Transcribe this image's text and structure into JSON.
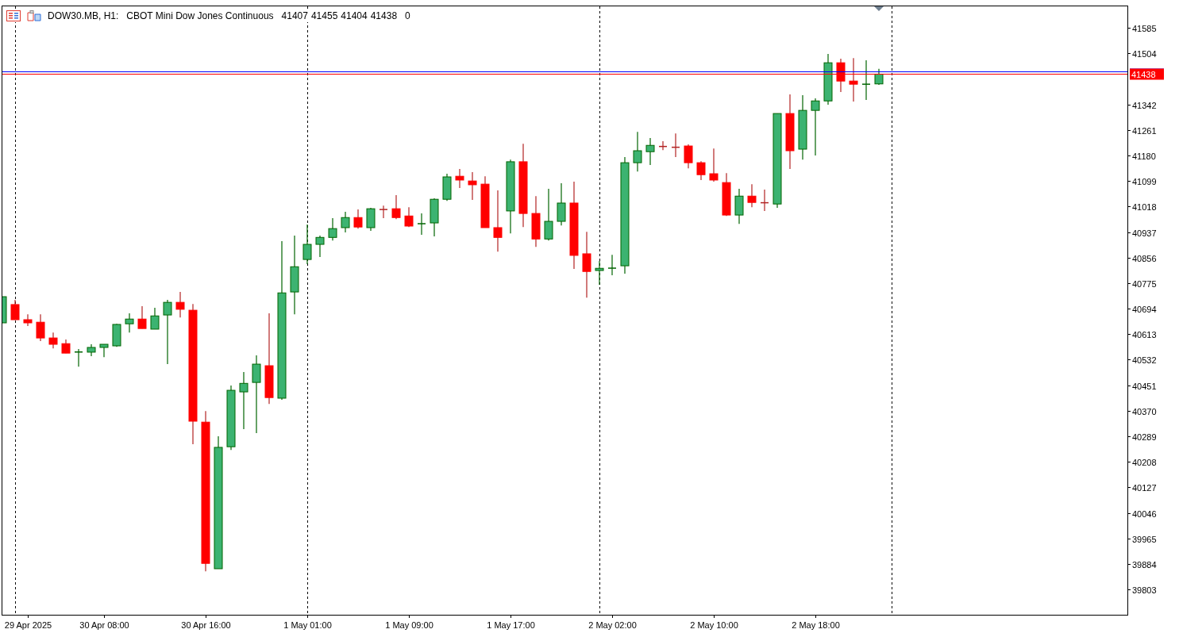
{
  "header": {
    "symbol": "DOW30.MB, H1:",
    "description": "CBOT Mini Dow Jones Continuous",
    "ohlc": [
      "41407",
      "41455",
      "41404",
      "41438"
    ],
    "volume": "0"
  },
  "chart": {
    "chart_data": {
      "type": "candlestick",
      "categories": [
        null,
        null,
        "29 Apr 2025",
        null,
        null,
        null,
        null,
        null,
        "30 Apr 08:00",
        null,
        null,
        null,
        null,
        null,
        null,
        null,
        "30 Apr 16:00",
        null,
        null,
        null,
        null,
        null,
        null,
        null,
        "1 May 01:00",
        null,
        null,
        null,
        null,
        null,
        null,
        null,
        "1 May 09:00",
        null,
        null,
        null,
        null,
        null,
        null,
        null,
        "1 May 17:00",
        null,
        null,
        null,
        null,
        null,
        null,
        null,
        "2 May 02:00",
        null,
        null,
        null,
        null,
        null,
        null,
        null,
        "2 May 10:00",
        null,
        null,
        null,
        null,
        null,
        null,
        null,
        "2 May 18:00",
        null,
        null,
        null,
        null,
        null,
        null,
        null,
        null,
        null,
        null,
        null,
        null,
        null,
        null,
        null,
        null,
        null,
        null,
        null,
        null,
        null,
        null,
        null,
        null
      ],
      "ylim": [
        39723,
        41653
      ],
      "grid": true,
      "yticks": [
        41585,
        41504,
        41342,
        41261,
        41180,
        41099,
        41018,
        40937,
        40856,
        40775,
        40694,
        40613,
        40532,
        40451,
        40370,
        40289,
        40208,
        40127,
        40046,
        39965,
        39884,
        39803
      ],
      "ohlc": [
        [
          40649,
          40732,
          40649,
          40732
        ],
        [
          40707,
          40722,
          40659,
          40659
        ],
        [
          40659,
          40676,
          40639,
          40649
        ],
        [
          40651,
          40676,
          40591,
          40601
        ],
        [
          40601,
          40618,
          40568,
          40581
        ],
        [
          40583,
          40596,
          40553,
          40553
        ],
        [
          40556,
          40566,
          40510,
          40557
        ],
        [
          40556,
          40581,
          40543,
          40571
        ],
        [
          40571,
          40581,
          40540,
          40581
        ],
        [
          40576,
          40646,
          40573,
          40644
        ],
        [
          40646,
          40679,
          40618,
          40661
        ],
        [
          40661,
          40702,
          40631,
          40631
        ],
        [
          40629,
          40697,
          40629,
          40671
        ],
        [
          40674,
          40722,
          40518,
          40714
        ],
        [
          40714,
          40747,
          40666,
          40692
        ],
        [
          40689,
          40709,
          40264,
          40337
        ],
        [
          40334,
          40369,
          39861,
          39886
        ],
        [
          39869,
          40289,
          39869,
          40254
        ],
        [
          40256,
          40450,
          40246,
          40435
        ],
        [
          40430,
          40493,
          40312,
          40457
        ],
        [
          40460,
          40546,
          40299,
          40518
        ],
        [
          40513,
          40679,
          40392,
          40412
        ],
        [
          40410,
          40908,
          40405,
          40744
        ],
        [
          40747,
          40926,
          40676,
          40827
        ],
        [
          40850,
          40961,
          40835,
          40898
        ],
        [
          40898,
          40926,
          40858,
          40920
        ],
        [
          40920,
          40981,
          40910,
          40948
        ],
        [
          40951,
          41001,
          40936,
          40983
        ],
        [
          40983,
          41009,
          40948,
          40953
        ],
        [
          40951,
          41014,
          40941,
          41011
        ],
        [
          41011,
          41021,
          40981,
          41006
        ],
        [
          41011,
          41054,
          40978,
          40983
        ],
        [
          40988,
          41016,
          40953,
          40956
        ],
        [
          40961,
          40996,
          40928,
          40966
        ],
        [
          40966,
          41044,
          40923,
          41041
        ],
        [
          41041,
          41122,
          41036,
          41112
        ],
        [
          41114,
          41137,
          41077,
          41102
        ],
        [
          41099,
          41127,
          41039,
          41087
        ],
        [
          41089,
          41114,
          40951,
          40951
        ],
        [
          40951,
          41069,
          40875,
          40920
        ],
        [
          41004,
          41167,
          40933,
          41160
        ],
        [
          41160,
          41217,
          40953,
          40996
        ],
        [
          40996,
          41051,
          40890,
          40915
        ],
        [
          40915,
          41074,
          40910,
          40971
        ],
        [
          40971,
          41092,
          40958,
          41029
        ],
        [
          41029,
          41097,
          40820,
          40863
        ],
        [
          40868,
          40938,
          40729,
          40812
        ],
        [
          40815,
          40845,
          40770,
          40822
        ],
        [
          40820,
          40865,
          40800,
          40825
        ],
        [
          40830,
          41175,
          40805,
          41157
        ],
        [
          41157,
          41255,
          41129,
          41195
        ],
        [
          41192,
          41235,
          41150,
          41212
        ],
        [
          41210,
          41225,
          41197,
          41207
        ],
        [
          41207,
          41250,
          41175,
          41205
        ],
        [
          41210,
          41215,
          41139,
          41157
        ],
        [
          41157,
          41162,
          41102,
          41119
        ],
        [
          41122,
          41202,
          41097,
          41102
        ],
        [
          41094,
          41124,
          40988,
          40991
        ],
        [
          40991,
          41074,
          40963,
          41051
        ],
        [
          41051,
          41089,
          41016,
          41031
        ],
        [
          41031,
          41072,
          41004,
          41029
        ],
        [
          41026,
          41313,
          41014,
          41313
        ],
        [
          41313,
          41374,
          41137,
          41195
        ],
        [
          41200,
          41371,
          41167,
          41323
        ],
        [
          41323,
          41361,
          41180,
          41353
        ],
        [
          41353,
          41502,
          41341,
          41474
        ],
        [
          41474,
          41487,
          41381,
          41416
        ],
        [
          41416,
          41489,
          41351,
          41406
        ],
        [
          41406,
          41482,
          41356,
          41406
        ],
        [
          41407,
          41455,
          41404,
          41438
        ],
        null,
        null,
        null,
        null,
        null,
        null,
        null,
        null,
        null,
        null,
        null,
        null,
        null,
        null,
        null,
        null,
        null,
        null,
        null
      ],
      "ref_lines": [
        {
          "axis": "y",
          "value": 41447,
          "color": "#0000ff"
        },
        {
          "axis": "y",
          "value": 41438,
          "color": "#ff0000",
          "label": "41438"
        }
      ]
    }
  }
}
